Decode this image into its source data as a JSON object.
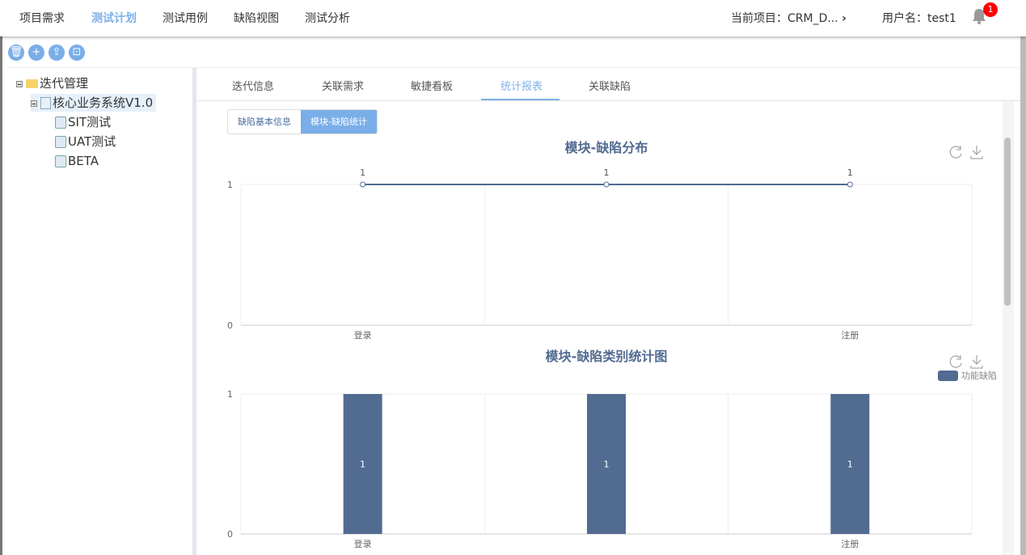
{
  "nav": {
    "items": [
      "项目需求",
      "测试计划",
      "测试用例",
      "缺陷视图",
      "测试分析"
    ],
    "active": 1,
    "project": "当前项目：CRM_D...",
    "user": "用户名：test1",
    "notifications": "1"
  },
  "toolbar": {
    "icons": [
      "trash-icon",
      "plus-icon",
      "upload-icon",
      "export-icon"
    ]
  },
  "tree": {
    "root": "迭代管理",
    "child": "核心业务系统V1.0",
    "leaves": [
      "SIT测试",
      "UAT测试",
      "BETA"
    ]
  },
  "tabs": [
    "迭代信息",
    "关联需求",
    "敏捷看板",
    "统计报表",
    "关联缺陷"
  ],
  "subtabs": [
    "缺陷基本信息",
    "模块-缺陷统计"
  ],
  "colors": {
    "accent": "#7fb2ea",
    "series": "#516b91"
  },
  "chart_data": [
    {
      "type": "line",
      "title": "模块-缺陷分布",
      "categories": [
        "登录",
        "",
        "注册"
      ],
      "values": [
        1,
        1,
        1
      ],
      "ylim": [
        0,
        1
      ],
      "yticks": [
        "0",
        "1"
      ],
      "grid": true
    },
    {
      "type": "bar",
      "title": "模块-缺陷类别统计图",
      "categories": [
        "登录",
        "",
        "注册"
      ],
      "series": [
        {
          "name": "功能缺陷",
          "values": [
            1,
            1,
            1
          ]
        }
      ],
      "ylim": [
        0,
        1
      ],
      "yticks": [
        "0",
        "1"
      ],
      "legend": "top-right",
      "grid": true
    }
  ]
}
